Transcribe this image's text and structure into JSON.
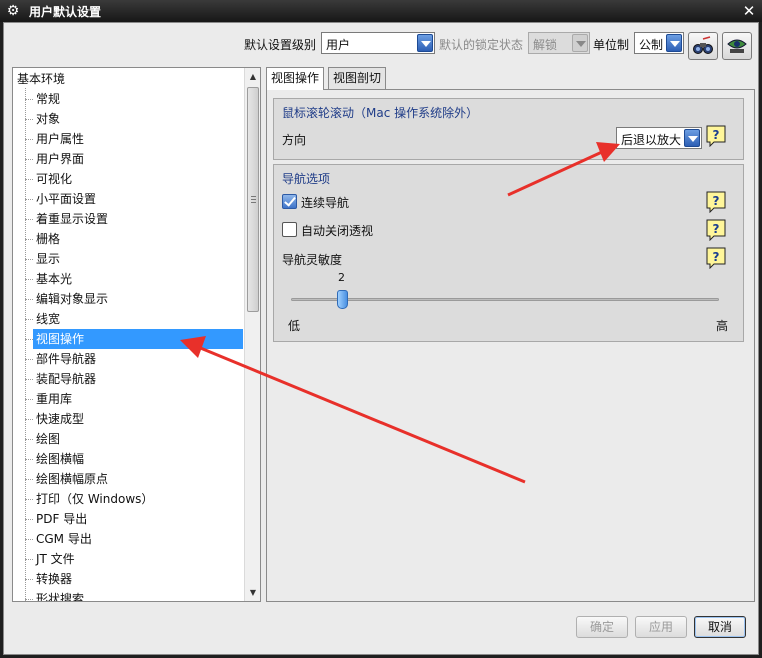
{
  "window": {
    "title": "用户默认设置",
    "close_icon": "close-icon"
  },
  "toolbar": {
    "level_label": "默认设置级别",
    "level_value": "用户",
    "lock_label": "默认的锁定状态",
    "lock_value": "解锁",
    "unit_label": "单位制",
    "unit_value": "公制",
    "search_icon": "binoculars-icon",
    "manage_icon": "manage-icon"
  },
  "tree": {
    "root": "基本环境",
    "items": [
      "常规",
      "对象",
      "用户属性",
      "用户界面",
      "可视化",
      "小平面设置",
      "着重显示设置",
      "栅格",
      "显示",
      "基本光",
      "编辑对象显示",
      "线宽",
      "视图操作",
      "部件导航器",
      "装配导航器",
      "重用库",
      "快速成型",
      "绘图",
      "绘图横幅",
      "绘图横幅原点",
      "打印（仅 Windows）",
      "PDF 导出",
      "CGM 导出",
      "JT 文件",
      "转换器",
      "形状搜索"
    ],
    "selected_index": 12
  },
  "tabs": [
    {
      "label": "视图操作",
      "active": true
    },
    {
      "label": "视图剖切",
      "active": false
    }
  ],
  "scroll_group": {
    "title": "鼠标滚轮滚动（Mac 操作系统除外）",
    "direction_label": "方向",
    "direction_value": "后退以放大"
  },
  "nav_group": {
    "title": "导航选项",
    "continuous_label": "连续导航",
    "continuous_checked": true,
    "autoclose_label": "自动关闭透视",
    "autoclose_checked": false,
    "sensitivity_label": "导航灵敏度",
    "sensitivity_value": "2",
    "low_label": "低",
    "high_label": "高"
  },
  "buttons": {
    "ok": "确定",
    "apply": "应用",
    "cancel": "取消"
  },
  "colors": {
    "selection": "#3399ff",
    "group_title": "#1f3c88",
    "annotation_arrow": "#e8302a"
  }
}
